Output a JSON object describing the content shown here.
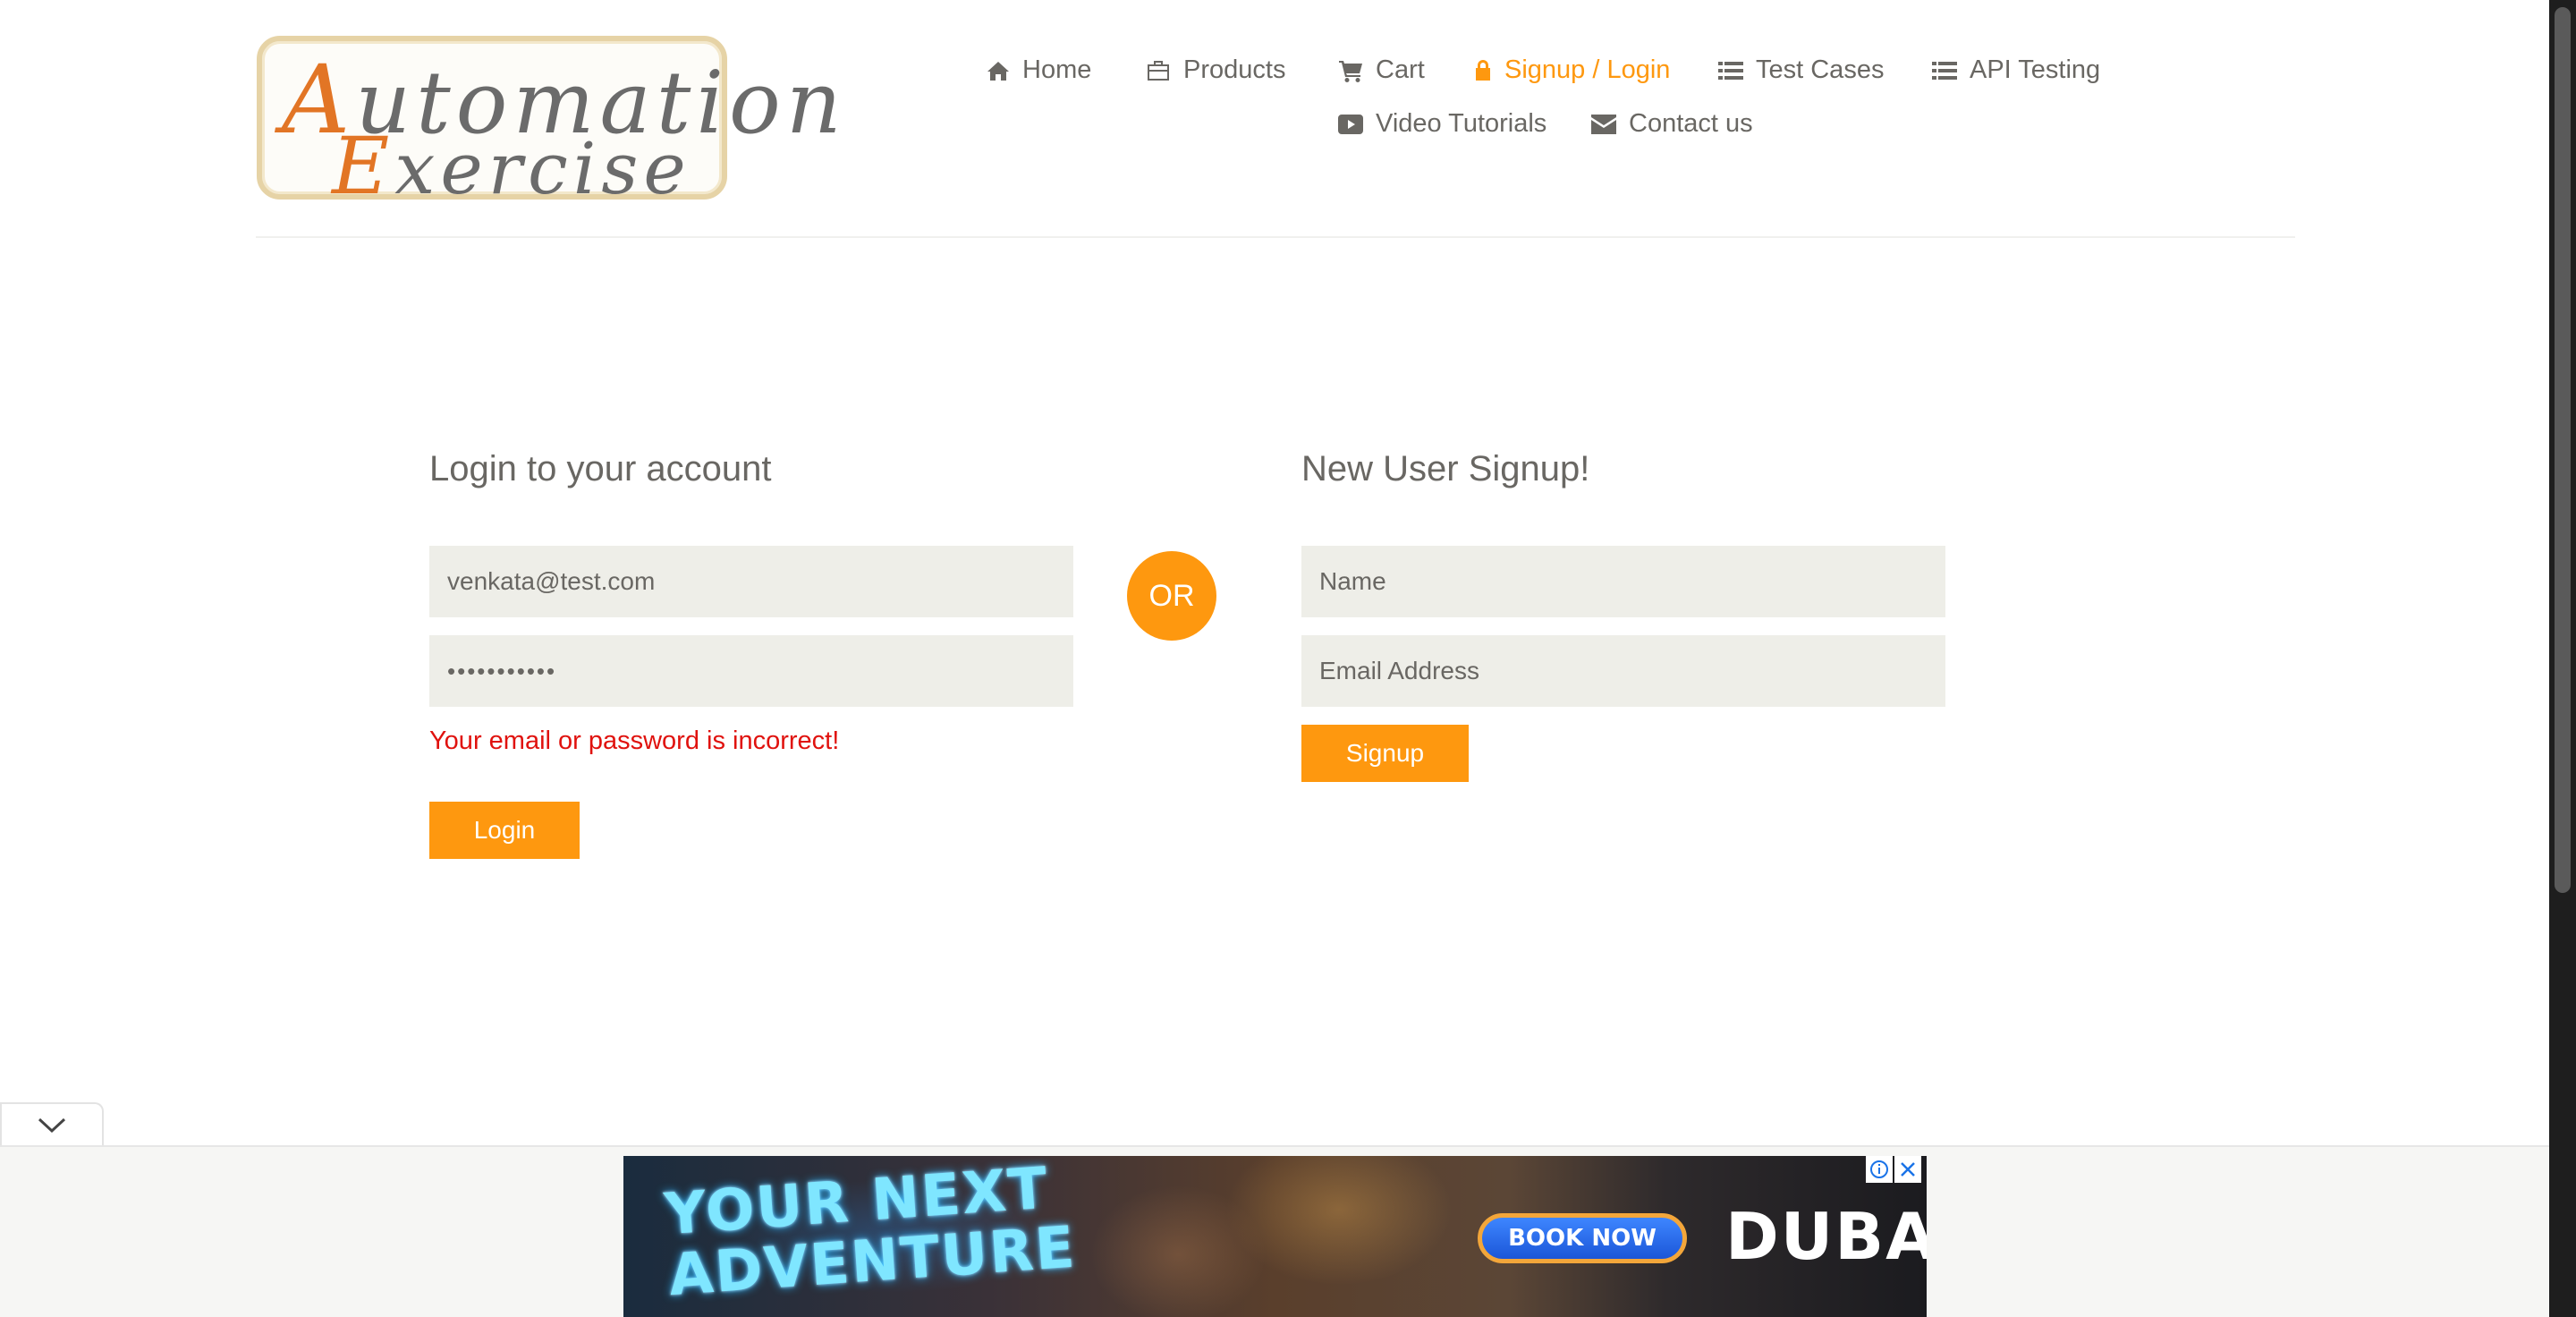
{
  "logo": {
    "line1_initial": "A",
    "line1_rest": "utomation",
    "line2_initial": "E",
    "line2_rest": "xercise"
  },
  "nav": {
    "items": [
      {
        "label": "Home",
        "icon": "home-icon"
      },
      {
        "label": "Products",
        "icon": "briefcase-icon"
      },
      {
        "label": "Cart",
        "icon": "cart-icon"
      },
      {
        "label": "Signup / Login",
        "icon": "lock-icon",
        "active": true
      },
      {
        "label": "Test Cases",
        "icon": "list-icon"
      },
      {
        "label": "API Testing",
        "icon": "list-icon"
      },
      {
        "label": "Video Tutorials",
        "icon": "youtube-play-icon"
      },
      {
        "label": "Contact us",
        "icon": "envelope-icon"
      }
    ]
  },
  "login": {
    "title": "Login to your account",
    "email_value": "venkata@test.com",
    "password_value": "•••••••••••",
    "error": "Your email or password is incorrect!",
    "button": "Login"
  },
  "divider": {
    "label": "OR"
  },
  "signup": {
    "title": "New User Signup!",
    "name_placeholder": "Name",
    "email_placeholder": "Email Address",
    "button": "Signup"
  },
  "ad": {
    "headline": "YOUR NEXT ADVENTURE",
    "cta": "BOOK NOW",
    "brand": "DUBAI"
  },
  "colors": {
    "accent": "#fe980f",
    "error": "#e0120e",
    "text": "#696763",
    "field_bg": "#eeeee8"
  }
}
